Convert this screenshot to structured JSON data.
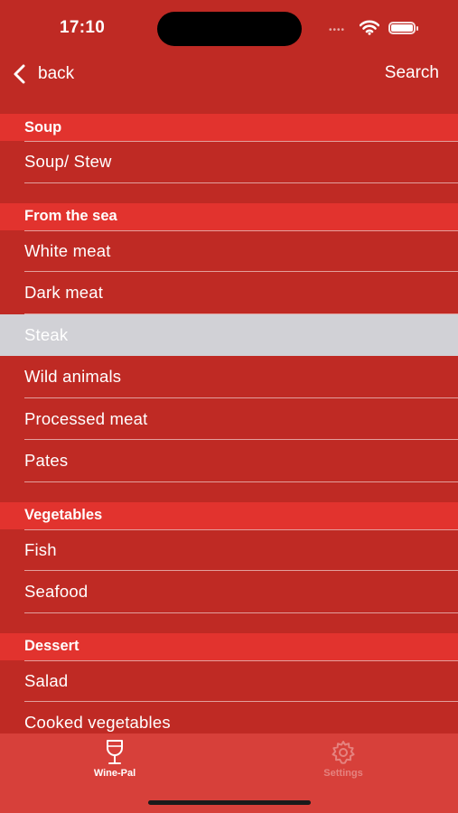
{
  "status": {
    "time": "17:10",
    "dots": "••••"
  },
  "nav": {
    "back_label": "back",
    "search_label": "Search"
  },
  "sections": [
    {
      "header": "Soup",
      "items": [
        "Soup/ Stew"
      ]
    },
    {
      "header": "From the sea",
      "items": [
        "White meat",
        "Dark meat",
        "Steak",
        "Wild animals",
        "Processed meat",
        "Pates"
      ]
    },
    {
      "header": "Vegetables",
      "items": [
        "Fish",
        "Seafood"
      ]
    },
    {
      "header": "Dessert",
      "items": [
        "Salad",
        "Cooked vegetables"
      ]
    }
  ],
  "selected_item": "Steak",
  "tabs": [
    {
      "label": "Wine-Pal",
      "icon": "wine-glass-icon",
      "active": true
    },
    {
      "label": "Settings",
      "icon": "gear-icon",
      "active": false
    }
  ],
  "colors": {
    "background": "#bf2a24",
    "section_header": "#e2332e",
    "selected_row": "#d1d1d6",
    "tab_bar": "#d7403a"
  }
}
